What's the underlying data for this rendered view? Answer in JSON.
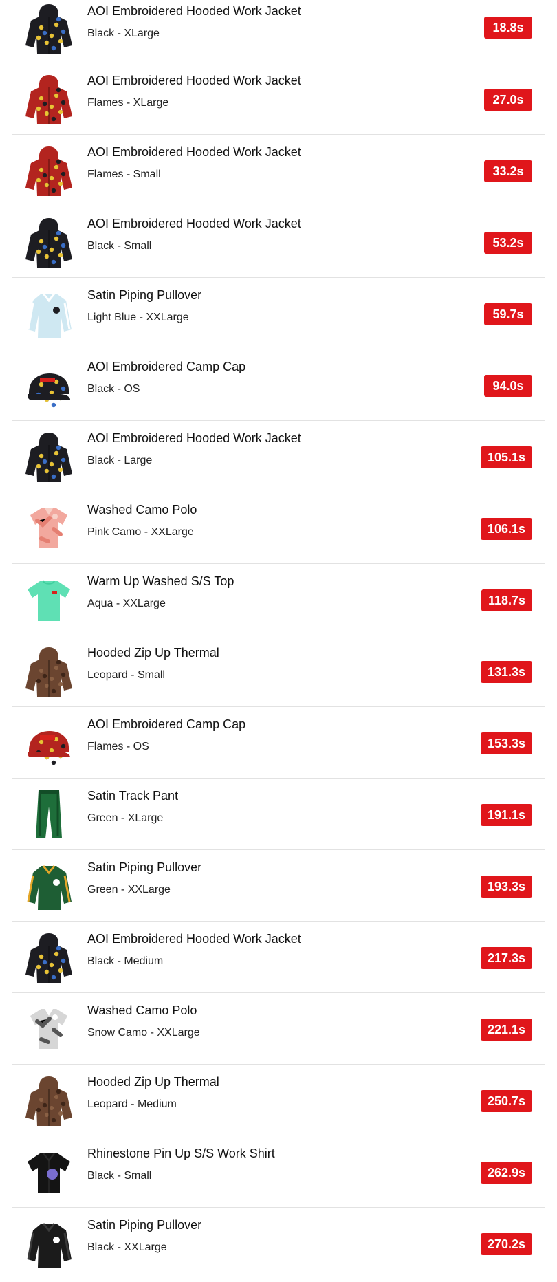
{
  "items": [
    {
      "name": "AOI Embroidered Hooded Work Jacket",
      "variant": "Black - XLarge",
      "time": "18.8s",
      "icon": "jacket-icon",
      "colors": [
        "#1d1d22",
        "#3a6ec6",
        "#e9c334"
      ]
    },
    {
      "name": "AOI Embroidered Hooded Work Jacket",
      "variant": "Flames - XLarge",
      "time": "27.0s",
      "icon": "jacket-icon",
      "colors": [
        "#b3241f",
        "#1d1d22",
        "#e9c334"
      ]
    },
    {
      "name": "AOI Embroidered Hooded Work Jacket",
      "variant": "Flames - Small",
      "time": "33.2s",
      "icon": "jacket-icon",
      "colors": [
        "#b3241f",
        "#1d1d22",
        "#e9c334"
      ]
    },
    {
      "name": "AOI Embroidered Hooded Work Jacket",
      "variant": "Black - Small",
      "time": "53.2s",
      "icon": "jacket-icon",
      "colors": [
        "#1d1d22",
        "#3a6ec6",
        "#e9c334"
      ]
    },
    {
      "name": "Satin Piping Pullover",
      "variant": "Light Blue - XXLarge",
      "time": "59.7s",
      "icon": "pullover-icon",
      "colors": [
        "#cfe8f2",
        "#ffffff",
        "#1d1d22"
      ]
    },
    {
      "name": "AOI Embroidered Camp Cap",
      "variant": "Black - OS",
      "time": "94.0s",
      "icon": "cap-icon",
      "colors": [
        "#1d1d22",
        "#3a6ec6",
        "#e9c334"
      ]
    },
    {
      "name": "AOI Embroidered Hooded Work Jacket",
      "variant": "Black - Large",
      "time": "105.1s",
      "icon": "jacket-icon",
      "colors": [
        "#1d1d22",
        "#3a6ec6",
        "#e9c334"
      ]
    },
    {
      "name": "Washed Camo Polo",
      "variant": "Pink Camo - XXLarge",
      "time": "106.1s",
      "icon": "polo-icon",
      "colors": [
        "#f2a89e",
        "#e57f72",
        "#f7d0c7"
      ]
    },
    {
      "name": "Warm Up Washed S/S Top",
      "variant": "Aqua - XXLarge",
      "time": "118.7s",
      "icon": "tshirt-icon",
      "colors": [
        "#5fe0b4",
        "#3fcf9e",
        "#d6221d"
      ]
    },
    {
      "name": "Hooded Zip Up Thermal",
      "variant": "Leopard - Small",
      "time": "131.3s",
      "icon": "hoodie-icon",
      "colors": [
        "#6b4530",
        "#3e2518",
        "#8a6044"
      ]
    },
    {
      "name": "AOI Embroidered Camp Cap",
      "variant": "Flames - OS",
      "time": "153.3s",
      "icon": "cap-icon",
      "colors": [
        "#b3241f",
        "#1d1d22",
        "#e9c334"
      ]
    },
    {
      "name": "Satin Track Pant",
      "variant": "Green - XLarge",
      "time": "191.1s",
      "icon": "pants-icon",
      "colors": [
        "#1e6e3a",
        "#124d27",
        "#ffffff"
      ]
    },
    {
      "name": "Satin Piping Pullover",
      "variant": "Green - XXLarge",
      "time": "193.3s",
      "icon": "pullover-icon",
      "colors": [
        "#1e5e34",
        "#e3a628",
        "#ffffff"
      ]
    },
    {
      "name": "AOI Embroidered Hooded Work Jacket",
      "variant": "Black - Medium",
      "time": "217.3s",
      "icon": "jacket-icon",
      "colors": [
        "#1d1d22",
        "#3a6ec6",
        "#e9c334"
      ]
    },
    {
      "name": "Washed Camo Polo",
      "variant": "Snow Camo - XXLarge",
      "time": "221.1s",
      "icon": "polo-icon",
      "colors": [
        "#d6d6d6",
        "#555555",
        "#ffffff"
      ]
    },
    {
      "name": "Hooded Zip Up Thermal",
      "variant": "Leopard - Medium",
      "time": "250.7s",
      "icon": "hoodie-icon",
      "colors": [
        "#6b4530",
        "#3e2518",
        "#8a6044"
      ]
    },
    {
      "name": "Rhinestone Pin Up S/S Work Shirt",
      "variant": "Black - Small",
      "time": "262.9s",
      "icon": "shirt-icon",
      "colors": [
        "#141414",
        "#2a2a2a",
        "#8b7cf0"
      ]
    },
    {
      "name": "Satin Piping Pullover",
      "variant": "Black - XXLarge",
      "time": "270.2s",
      "icon": "pullover-icon",
      "colors": [
        "#1b1b1b",
        "#3a3a3a",
        "#ffffff"
      ]
    }
  ]
}
